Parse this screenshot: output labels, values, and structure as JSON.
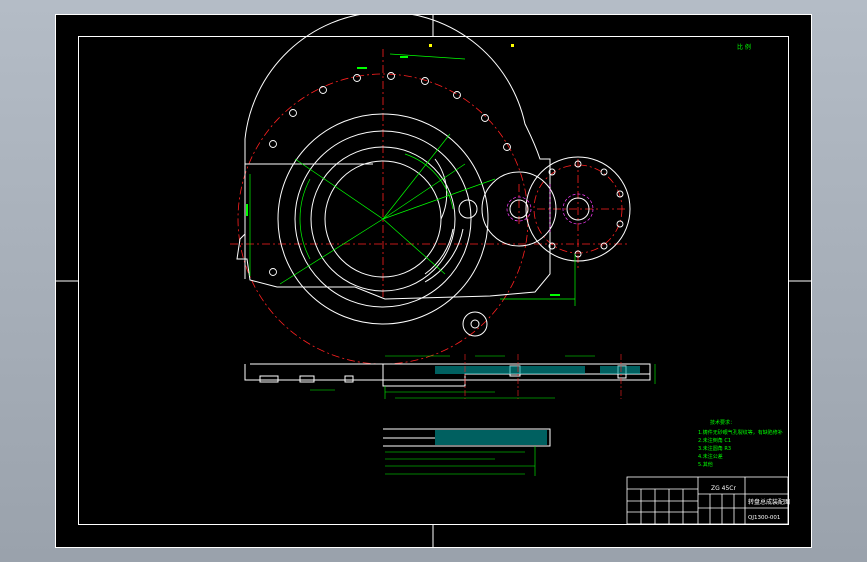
{
  "drawing": {
    "scale_note": "比 例"
  },
  "tech_requirements": {
    "title": "技术要求：",
    "items": [
      "1.铸件无砂眼气孔裂纹等，有缺陷修补",
      "2.未注倒角 C1",
      "3.未注圆角 R3",
      "4.未注公差",
      "5.其他"
    ]
  },
  "title_block": {
    "material": "ZG 45Cr",
    "part_name": "转盘总成装配图",
    "drawing_no": "QJ1300-001"
  },
  "colors": {
    "sheet": "#000000",
    "outline": "#ffffff",
    "centerline": "#ff2020",
    "dimension": "#00ff00",
    "hatch": "#00ffff",
    "hole": "#ff3cff",
    "accent": "#ffff00"
  }
}
